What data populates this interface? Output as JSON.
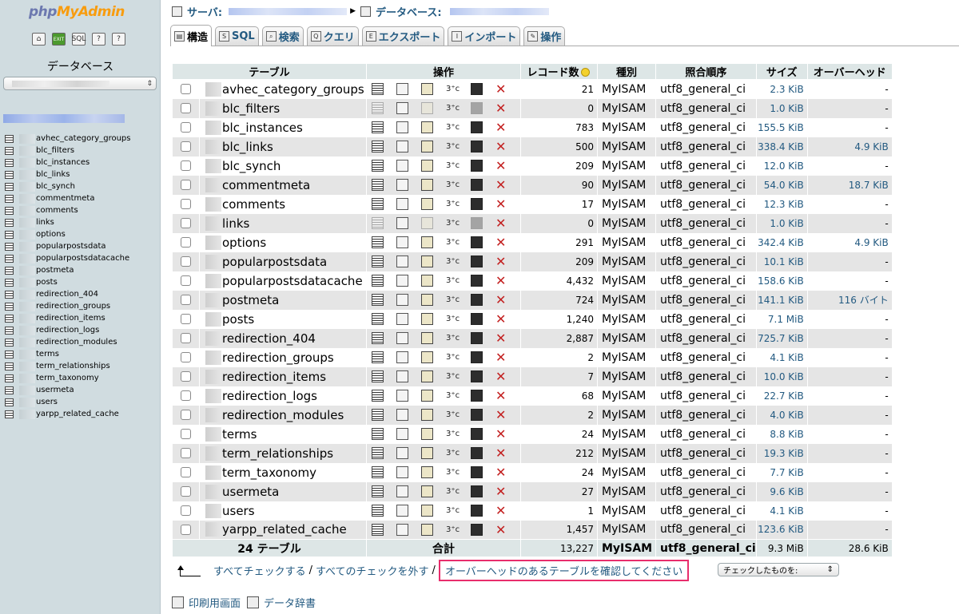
{
  "navigation": {
    "logo": {
      "php": "php",
      "my": "My",
      "admin": "Admin"
    },
    "database_label": "データベース",
    "tables": [
      "avhec_category_groups",
      "blc_filters",
      "blc_instances",
      "blc_links",
      "blc_synch",
      "commentmeta",
      "comments",
      "links",
      "options",
      "popularpostsdata",
      "popularpostsdatacache",
      "postmeta",
      "posts",
      "redirection_404",
      "redirection_groups",
      "redirection_items",
      "redirection_logs",
      "redirection_modules",
      "terms",
      "term_relationships",
      "term_taxonomy",
      "usermeta",
      "users",
      "yarpp_related_cache"
    ]
  },
  "breadcrumb": {
    "server": "サーバ:",
    "database": "データベース:"
  },
  "tabs": [
    {
      "label": "構造",
      "icon": "structure-icon"
    },
    {
      "label": "SQL",
      "icon": "sql-icon"
    },
    {
      "label": "検索",
      "icon": "search-icon"
    },
    {
      "label": "クエリ",
      "icon": "query-icon"
    },
    {
      "label": "エクスポート",
      "icon": "export-icon"
    },
    {
      "label": "インポート",
      "icon": "import-icon"
    },
    {
      "label": "操作",
      "icon": "operations-icon"
    }
  ],
  "table": {
    "headers": {
      "table": "テーブル",
      "action": "操作",
      "records": "レコード数",
      "type": "種別",
      "collation": "照合順序",
      "size": "サイズ",
      "overhead": "オーバーヘッド"
    },
    "rows": [
      {
        "name": "avhec_category_groups",
        "records": "21",
        "type": "MyISAM",
        "collation": "utf8_general_ci",
        "size": "2.3 KiB",
        "overhead": "-",
        "empty": false
      },
      {
        "name": "blc_filters",
        "records": "0",
        "type": "MyISAM",
        "collation": "utf8_general_ci",
        "size": "1.0 KiB",
        "overhead": "-",
        "empty": true
      },
      {
        "name": "blc_instances",
        "records": "783",
        "type": "MyISAM",
        "collation": "utf8_general_ci",
        "size": "155.5 KiB",
        "overhead": "-",
        "empty": false
      },
      {
        "name": "blc_links",
        "records": "500",
        "type": "MyISAM",
        "collation": "utf8_general_ci",
        "size": "338.4 KiB",
        "overhead": "4.9 KiB",
        "empty": false
      },
      {
        "name": "blc_synch",
        "records": "209",
        "type": "MyISAM",
        "collation": "utf8_general_ci",
        "size": "12.0 KiB",
        "overhead": "-",
        "empty": false
      },
      {
        "name": "commentmeta",
        "records": "90",
        "type": "MyISAM",
        "collation": "utf8_general_ci",
        "size": "54.0 KiB",
        "overhead": "18.7 KiB",
        "empty": false
      },
      {
        "name": "comments",
        "records": "17",
        "type": "MyISAM",
        "collation": "utf8_general_ci",
        "size": "12.3 KiB",
        "overhead": "-",
        "empty": false
      },
      {
        "name": "links",
        "records": "0",
        "type": "MyISAM",
        "collation": "utf8_general_ci",
        "size": "1.0 KiB",
        "overhead": "-",
        "empty": true
      },
      {
        "name": "options",
        "records": "291",
        "type": "MyISAM",
        "collation": "utf8_general_ci",
        "size": "342.4 KiB",
        "overhead": "4.9 KiB",
        "empty": false
      },
      {
        "name": "popularpostsdata",
        "records": "209",
        "type": "MyISAM",
        "collation": "utf8_general_ci",
        "size": "10.1 KiB",
        "overhead": "-",
        "empty": false
      },
      {
        "name": "popularpostsdatacache",
        "records": "4,432",
        "type": "MyISAM",
        "collation": "utf8_general_ci",
        "size": "158.6 KiB",
        "overhead": "-",
        "empty": false
      },
      {
        "name": "postmeta",
        "records": "724",
        "type": "MyISAM",
        "collation": "utf8_general_ci",
        "size": "141.1 KiB",
        "overhead": "116 バイト",
        "empty": false
      },
      {
        "name": "posts",
        "records": "1,240",
        "type": "MyISAM",
        "collation": "utf8_general_ci",
        "size": "7.1 MiB",
        "overhead": "-",
        "empty": false
      },
      {
        "name": "redirection_404",
        "records": "2,887",
        "type": "MyISAM",
        "collation": "utf8_general_ci",
        "size": "725.7 KiB",
        "overhead": "-",
        "empty": false
      },
      {
        "name": "redirection_groups",
        "records": "2",
        "type": "MyISAM",
        "collation": "utf8_general_ci",
        "size": "4.1 KiB",
        "overhead": "-",
        "empty": false
      },
      {
        "name": "redirection_items",
        "records": "7",
        "type": "MyISAM",
        "collation": "utf8_general_ci",
        "size": "10.0 KiB",
        "overhead": "-",
        "empty": false
      },
      {
        "name": "redirection_logs",
        "records": "68",
        "type": "MyISAM",
        "collation": "utf8_general_ci",
        "size": "22.7 KiB",
        "overhead": "-",
        "empty": false
      },
      {
        "name": "redirection_modules",
        "records": "2",
        "type": "MyISAM",
        "collation": "utf8_general_ci",
        "size": "4.0 KiB",
        "overhead": "-",
        "empty": false
      },
      {
        "name": "terms",
        "records": "24",
        "type": "MyISAM",
        "collation": "utf8_general_ci",
        "size": "8.8 KiB",
        "overhead": "-",
        "empty": false
      },
      {
        "name": "term_relationships",
        "records": "212",
        "type": "MyISAM",
        "collation": "utf8_general_ci",
        "size": "19.3 KiB",
        "overhead": "-",
        "empty": false
      },
      {
        "name": "term_taxonomy",
        "records": "24",
        "type": "MyISAM",
        "collation": "utf8_general_ci",
        "size": "7.7 KiB",
        "overhead": "-",
        "empty": false
      },
      {
        "name": "usermeta",
        "records": "27",
        "type": "MyISAM",
        "collation": "utf8_general_ci",
        "size": "9.6 KiB",
        "overhead": "-",
        "empty": false
      },
      {
        "name": "users",
        "records": "1",
        "type": "MyISAM",
        "collation": "utf8_general_ci",
        "size": "4.1 KiB",
        "overhead": "-",
        "empty": false
      },
      {
        "name": "yarpp_related_cache",
        "records": "1,457",
        "type": "MyISAM",
        "collation": "utf8_general_ci",
        "size": "123.6 KiB",
        "overhead": "-",
        "empty": false
      }
    ],
    "footer": {
      "count": "24 テーブル",
      "sum_label": "合計",
      "records": "13,227",
      "type": "MyISAM",
      "collation": "utf8_general_ci",
      "size": "9.3 MiB",
      "overhead": "28.6 KiB"
    }
  },
  "actions": {
    "check_all": "すべてチェックする",
    "uncheck_all": "すべてのチェックを外す",
    "check_overhead": "オーバーヘッドのあるテーブルを確認してください",
    "with_selected": "チェックしたものを:",
    "separator": "/"
  },
  "bottom": {
    "print_view": "印刷用画面",
    "data_dictionary": "データ辞書"
  }
}
